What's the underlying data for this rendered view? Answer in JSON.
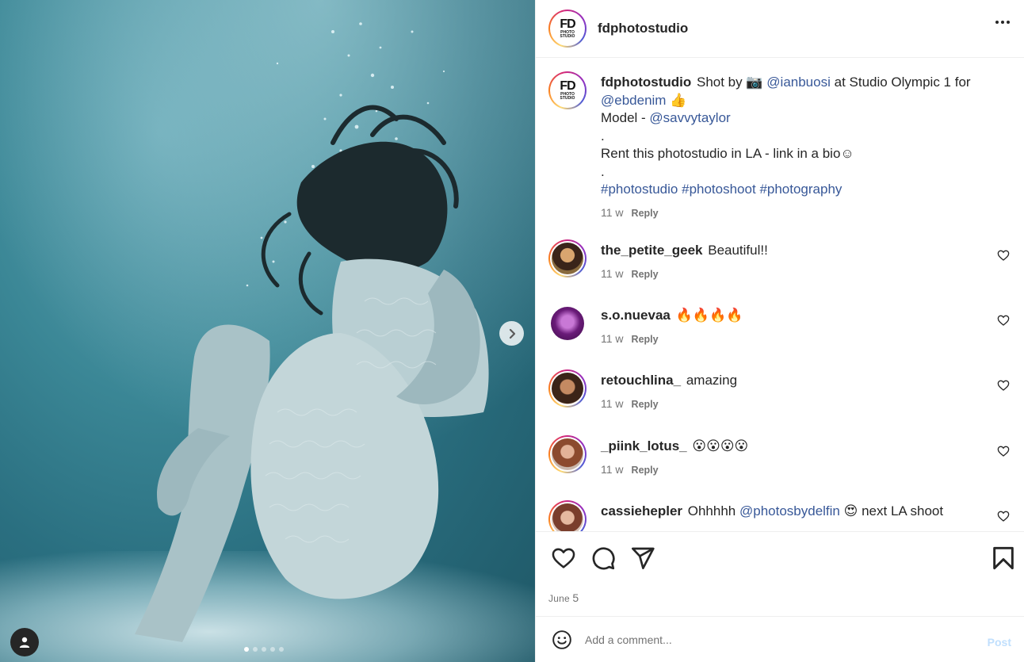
{
  "post": {
    "author": "fdphotostudio",
    "logo_text_top": "FD",
    "logo_text_bottom": "PHOTO STUDIO",
    "caption": {
      "username": "fdphotostudio",
      "line1_a": "Shot by",
      "camera_emoji": "📷",
      "line1_mention": "@ianbuosi",
      "line1_b": "at Studio Olympic 1 for",
      "line2_mention": "@ebdenim",
      "line2_emoji": "👍",
      "line3_a": "Model -",
      "line3_mention": "@savvytaylor",
      "line4": ".",
      "line5": "Rent this photostudio in LA - link in a bio☺",
      "line6": ".",
      "hashtags": [
        "#photostudio",
        "#photoshoot",
        "#photography"
      ],
      "time": "11 w",
      "reply": "Reply"
    },
    "comments": [
      {
        "username": "the_petite_geek",
        "text": "Beautiful!!",
        "time": "11 w",
        "reply": "Reply",
        "avatar_color": "#5a3a2a"
      },
      {
        "username": "s.o.nuevaa",
        "text": "🔥🔥🔥🔥",
        "time": "11 w",
        "reply": "Reply",
        "avatar_color": "#7a1f86"
      },
      {
        "username": "retouchlina_",
        "text": "amazing",
        "time": "11 w",
        "reply": "Reply",
        "avatar_color": "#8a5a3c"
      },
      {
        "username": "_piink_lotus_",
        "text": "😮😮😮😮",
        "time": "11 w",
        "reply": "Reply",
        "avatar_color": "#9c5a3e"
      },
      {
        "username": "cassiehepler",
        "text_a": "Ohhhhh",
        "mention": "@photosbydelfin",
        "emoji": "😍",
        "text_b": "next LA shoot",
        "avatar_color": "#6b3b2b"
      }
    ],
    "date_month": "June",
    "date_day": "5",
    "comment_placeholder": "Add a comment...",
    "post_label": "Post",
    "carousel": {
      "total_slides": 5,
      "active_index": 0
    }
  },
  "icons": {
    "more": "more-options-icon",
    "like": "heart-icon",
    "comment": "comment-icon",
    "share": "share-icon",
    "save": "bookmark-icon",
    "emoji": "emoji-icon",
    "next": "chevron-right-icon",
    "user_tags": "user-tag-icon"
  },
  "colors": {
    "link": "#385898",
    "muted": "#737373",
    "post_disabled": "#c0dffd"
  }
}
